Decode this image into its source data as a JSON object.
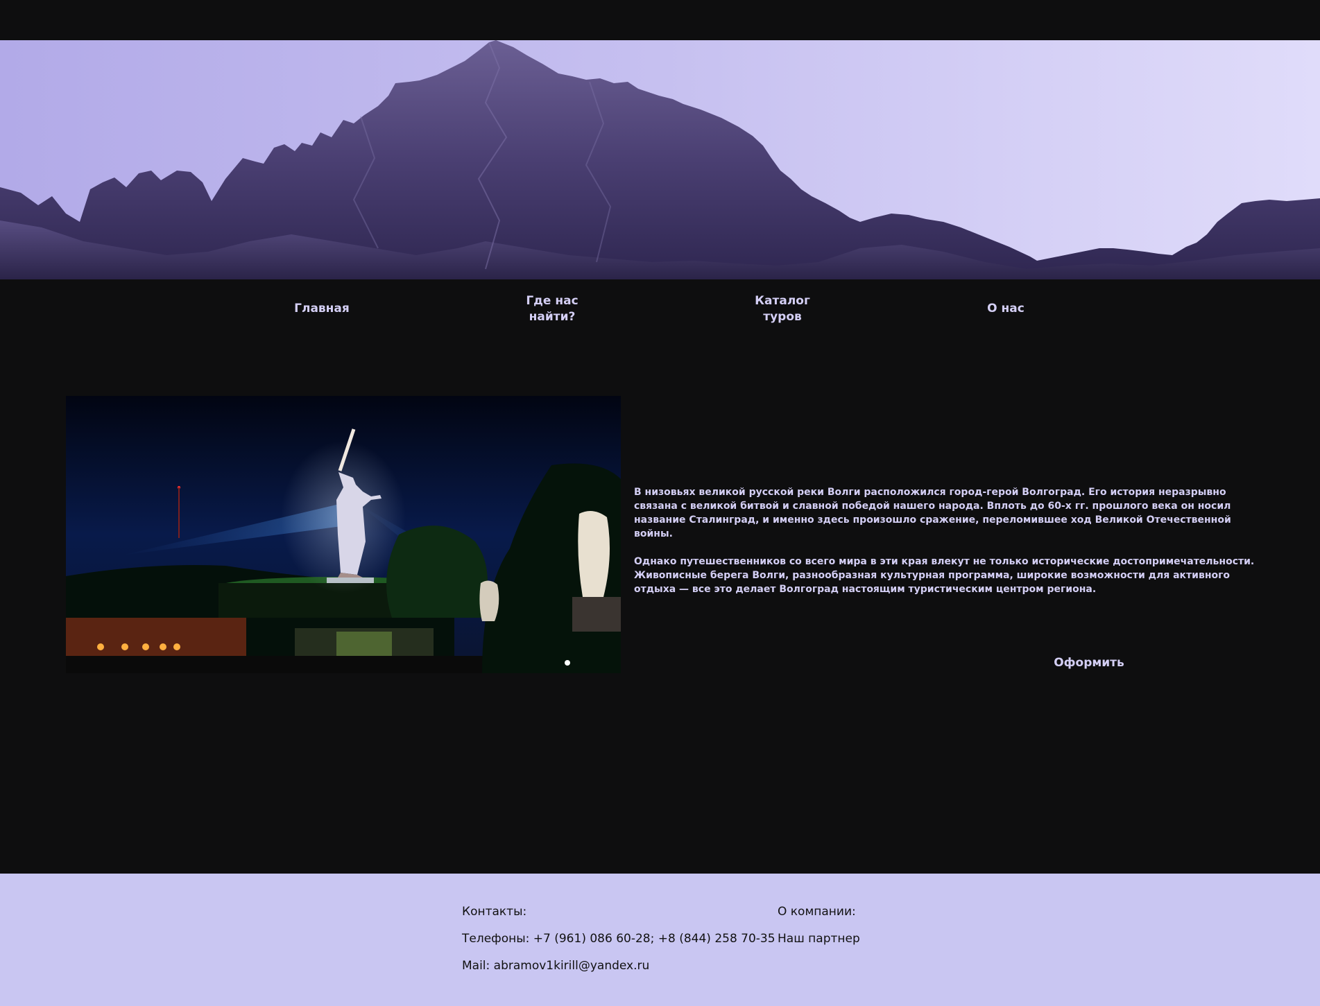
{
  "nav": {
    "items": [
      {
        "label": "Главная"
      },
      {
        "label_line1": "Где нас",
        "label_line2": "найти?"
      },
      {
        "label_line1": "Каталог",
        "label_line2": "туров"
      },
      {
        "label": "О нас"
      }
    ]
  },
  "main": {
    "paragraph1": "В низовьях великой русской реки Волги расположился город-герой Волгоград. Его история неразрывно связана с великой битвой и славной победой нашего народа. Вплоть до 60-х гг. прошлого века он носил название Сталинград, и именно здесь произошло сражение, переломившее ход Великой Отечественной войны.",
    "paragraph2": "Однако путешественников со всего мира в эти края влекут не только исторические достопримечательности. Живописные берега Волги, разнообразная культурная программа, широкие возможности для активного отдыха — все это делает Волгоград настоящим туристическим центром региона.",
    "cta_label": "Оформить"
  },
  "footer": {
    "contacts_heading": "Контакты:",
    "phones": "Телефоны: +7 (961) 086 60-28; +8 (844) 258 70-35",
    "mail": "Mail: abramov1kirill@yandex.ru",
    "company_heading": "О компании:",
    "partner_link": "Наш партнер"
  },
  "colors": {
    "background": "#0e0e0f",
    "accent_text": "#d4cff5",
    "footer_bg": "#c9c6f2",
    "sky": "#c6c0f0"
  }
}
